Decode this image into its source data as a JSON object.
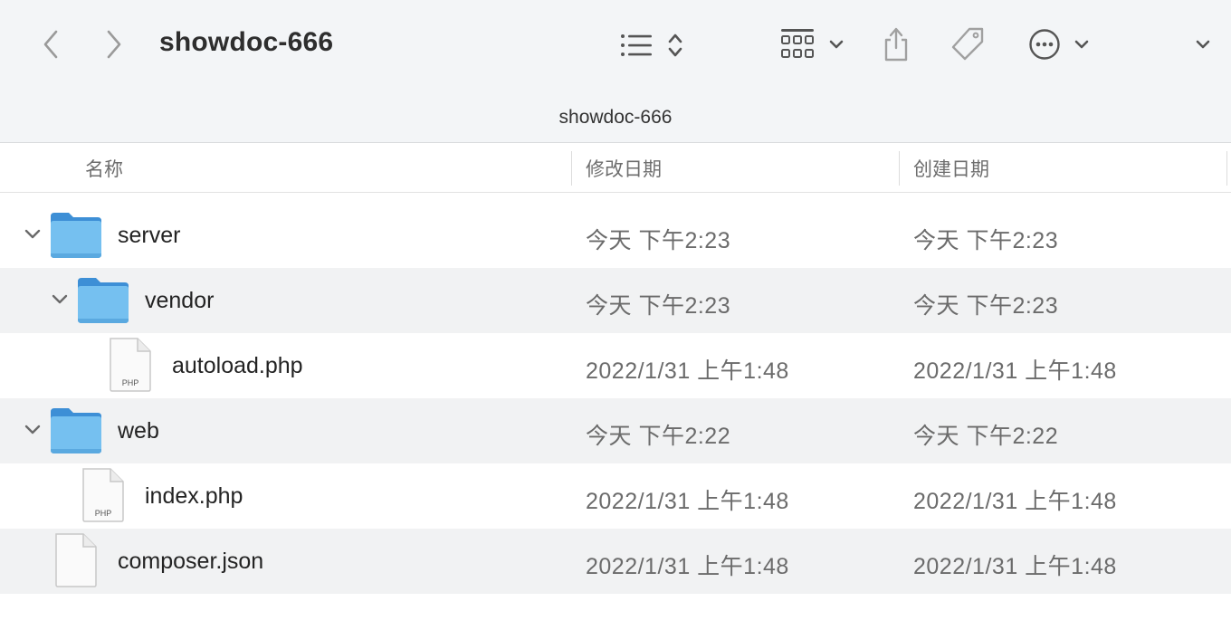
{
  "toolbar": {
    "title": "showdoc-666",
    "path_title": "showdoc-666",
    "icons": [
      "chevron-left-icon",
      "chevron-right-icon",
      "list-view-icon",
      "sort-arrows-icon",
      "grid-view-icon",
      "share-icon",
      "tag-icon",
      "more-icon",
      "chevron-down-icon"
    ]
  },
  "columns": {
    "name": "名称",
    "modified": "修改日期",
    "created": "创建日期"
  },
  "files": [
    {
      "name": "server",
      "kind": "folder",
      "depth": 0,
      "expanded": true,
      "modified": "今天 下午2:23",
      "created": "今天 下午2:23"
    },
    {
      "name": "vendor",
      "kind": "folder",
      "depth": 1,
      "expanded": true,
      "modified": "今天 下午2:23",
      "created": "今天 下午2:23"
    },
    {
      "name": "autoload.php",
      "kind": "php",
      "badge": "PHP",
      "depth": 2,
      "modified": "2022/1/31 上午1:48",
      "created": "2022/1/31 上午1:48"
    },
    {
      "name": "web",
      "kind": "folder",
      "depth": 0,
      "expanded": true,
      "modified": "今天 下午2:22",
      "created": "今天 下午2:22"
    },
    {
      "name": "index.php",
      "kind": "php",
      "badge": "PHP",
      "depth": 1,
      "modified": "2022/1/31 上午1:48",
      "created": "2022/1/31 上午1:48"
    },
    {
      "name": "composer.json",
      "kind": "doc",
      "depth": 0,
      "modified": "2022/1/31 上午1:48",
      "created": "2022/1/31 上午1:48"
    }
  ],
  "colors": {
    "toolbar_bg": "#f3f5f7",
    "row_alt": "#f1f2f3",
    "folder_blue": "#6cb8ec"
  }
}
